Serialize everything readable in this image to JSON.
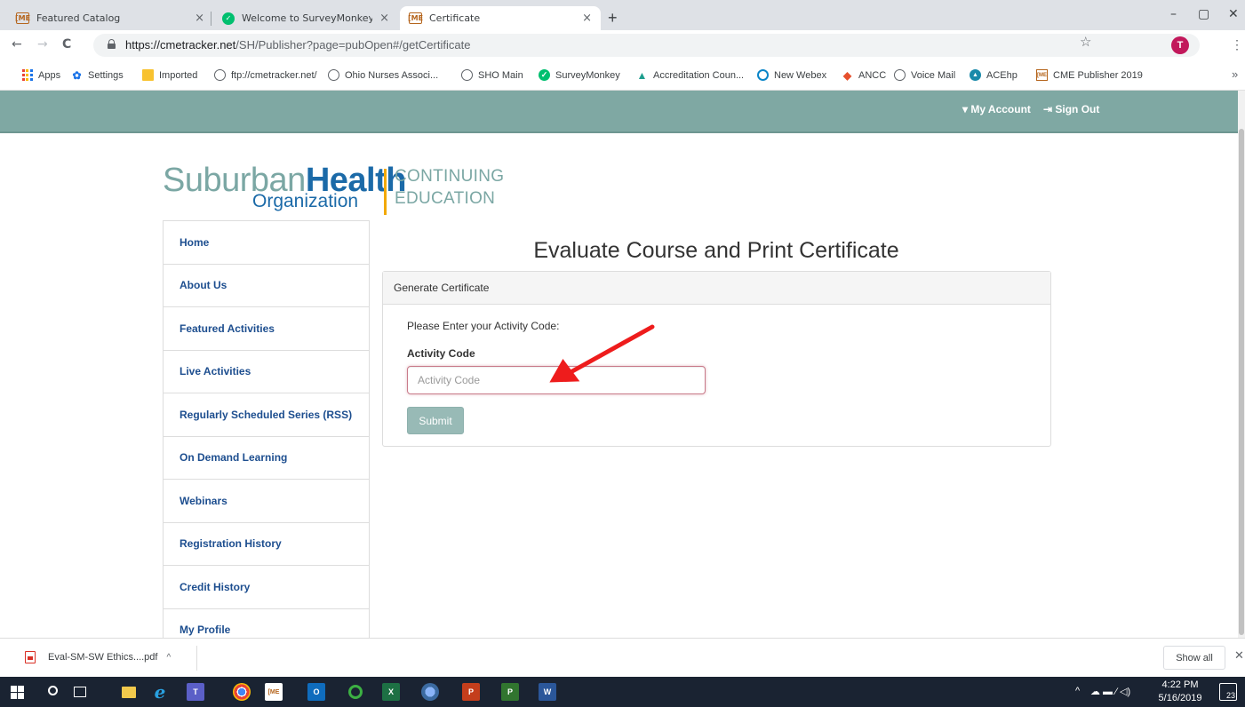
{
  "browser": {
    "tabs": [
      {
        "label": "Featured Catalog",
        "favicon": "cme-icon",
        "close": "×"
      },
      {
        "label": "Welcome to SurveyMonkey!",
        "favicon": "surveymonkey-icon",
        "close": "×"
      },
      {
        "label": "Certificate",
        "favicon": "cme-icon",
        "close": "×",
        "active": true
      }
    ],
    "favicon_text": {
      "cme": "[ME",
      "sm": "✓"
    },
    "new_tab": "+",
    "window_controls": {
      "minimize": "–",
      "maximize": "▢",
      "close": "✕"
    },
    "nav": {
      "back": "←",
      "forward": "→",
      "reload": "C"
    },
    "url": {
      "host": "https://cmetracker.net",
      "path": "/SH/Publisher?page=pubOpen#/getCertificate"
    },
    "star": "☆",
    "profile_initial": "T",
    "menu": "⋮",
    "bookmarks": [
      {
        "label": "Apps",
        "icon": "apps-icon"
      },
      {
        "label": "Settings",
        "icon": "gear-icon"
      },
      {
        "label": "Imported",
        "icon": "folder-icon"
      },
      {
        "label": "ftp://cmetracker.net/",
        "icon": "globe-icon"
      },
      {
        "label": "Ohio Nurses Associ...",
        "icon": "globe-icon"
      },
      {
        "label": "SHO Main",
        "icon": "globe-icon"
      },
      {
        "label": "SurveyMonkey",
        "icon": "surveymonkey-icon"
      },
      {
        "label": "Accreditation Coun...",
        "icon": "accreditation-icon"
      },
      {
        "label": "New Webex",
        "icon": "webex-icon"
      },
      {
        "label": "ANCC",
        "icon": "ancc-icon"
      },
      {
        "label": "Voice Mail",
        "icon": "globe-icon"
      },
      {
        "label": "ACEhp",
        "icon": "acehp-icon"
      },
      {
        "label": "CME Publisher 2019",
        "icon": "cme-icon"
      }
    ],
    "bookmarks_overflow": "»"
  },
  "site": {
    "account_label": "▾ My Account",
    "signout_label": "⇥ Sign Out",
    "logo": {
      "suburban": "Suburban",
      "health": "Health",
      "organization": "Organization",
      "continuing": "CONTINUING",
      "education": "EDUCATION"
    },
    "sidebar": [
      {
        "label": "Home"
      },
      {
        "label": "About Us"
      },
      {
        "label": "Featured Activities"
      },
      {
        "label": "Live Activities"
      },
      {
        "label": "Regularly Scheduled Series (RSS)"
      },
      {
        "label": "On Demand Learning"
      },
      {
        "label": "Webinars"
      },
      {
        "label": "Registration History"
      },
      {
        "label": "Credit History"
      },
      {
        "label": "My Profile"
      }
    ],
    "page_title": "Evaluate Course and Print Certificate",
    "panel": {
      "heading": "Generate Certificate",
      "prompt": "Please Enter your Activity Code:",
      "field_label": "Activity Code",
      "field_placeholder": "Activity Code",
      "field_value": "",
      "submit_label": "Submit"
    },
    "colors": {
      "header_bar": "#7fa8a3",
      "nav_link": "#1d4e8f",
      "submit": "#98bab6",
      "arrow": "#ee1c1c"
    }
  },
  "downloads": {
    "file": "Eval-SM-SW Ethics....pdf",
    "chevron": "^",
    "show_all": "Show all",
    "close": "✕"
  },
  "taskbar": {
    "apps": [
      "windows-start-icon",
      "search-icon",
      "task-view-icon",
      "file-explorer-icon",
      "internet-explorer-icon",
      "teams-icon",
      "chrome-icon",
      "cme-icon",
      "outlook-icon",
      "green-ring-app-icon",
      "excel-icon",
      "globe-app-icon",
      "powerpoint-icon",
      "project-icon",
      "word-icon"
    ],
    "app_glyphs": {
      "ie": "e",
      "teams": "T",
      "cme": "[ME",
      "outlook": "O",
      "excel": "X",
      "ppt": "P",
      "project": "P",
      "word": "W"
    },
    "tray": "^",
    "tray_icons": "☁ ▬ ∕ ◁)",
    "time": "4:22 PM",
    "date": "5/16/2019",
    "notifications": "23"
  }
}
